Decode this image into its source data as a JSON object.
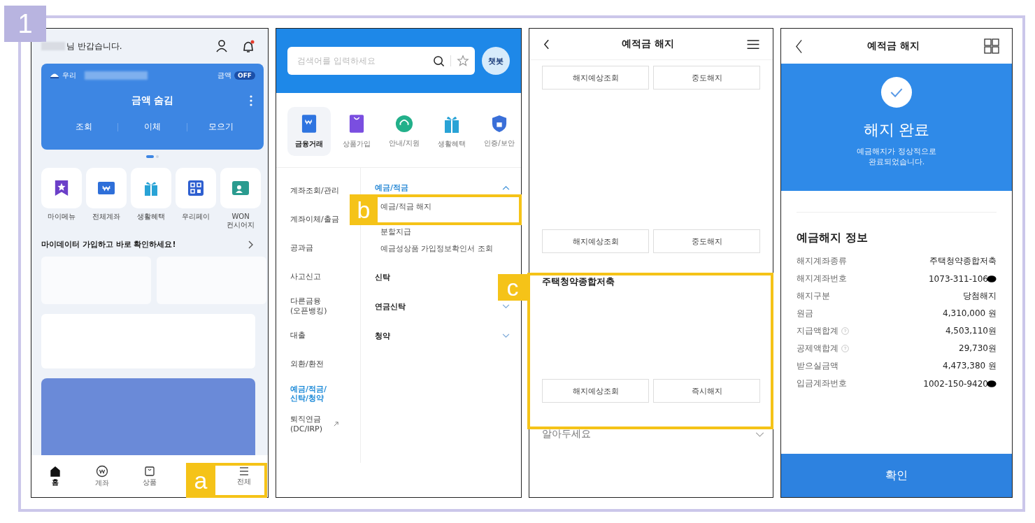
{
  "step_badge": "1",
  "annotations": [
    {
      "label": "a"
    },
    {
      "label": "b"
    },
    {
      "label": "c"
    }
  ],
  "home": {
    "greeting": "님 반갑습니다.",
    "account_card": {
      "bank": "우리",
      "toggle_label": "금액",
      "toggle": "OFF",
      "balance": "금액 숨김",
      "actions": [
        "조회",
        "이체",
        "모으기"
      ]
    },
    "pages": [
      {
        "selected": true
      },
      {
        "selected": false
      }
    ],
    "quick_menu": [
      {
        "label": "마이메뉴",
        "kind": "star"
      },
      {
        "label": "전체계좌",
        "kind": "won"
      },
      {
        "label": "생활혜택",
        "kind": "gift"
      },
      {
        "label": "우리페이",
        "kind": "qr"
      },
      {
        "label": "WON\n컨시어지",
        "kind": "concierge"
      }
    ],
    "mydata_banner": "마이데이터 가입하고 바로 확인하세요!",
    "nav": [
      {
        "label": "홈",
        "kind": "home",
        "selected": true
      },
      {
        "label": "계좌",
        "kind": "won",
        "selected": false
      },
      {
        "label": "상품",
        "kind": "bag",
        "selected": false
      },
      {
        "label": "전체",
        "kind": "menu",
        "selected": false
      }
    ]
  },
  "menu": {
    "search_placeholder": "검색어를 입력하세요",
    "chatbot": "챗봇",
    "categories": [
      {
        "label": "금융거래",
        "kind": "won",
        "selected": true
      },
      {
        "label": "상품가입",
        "kind": "bag",
        "selected": false
      },
      {
        "label": "안내/지원",
        "kind": "headset",
        "selected": false
      },
      {
        "label": "생활혜택",
        "kind": "gift",
        "selected": false
      },
      {
        "label": "인증/보안",
        "kind": "shield",
        "selected": false
      }
    ],
    "sidebar": [
      {
        "label": "계좌조회/관리",
        "selected": false
      },
      {
        "label": "계좌이체/출금",
        "selected": false
      },
      {
        "label": "공과금",
        "selected": false
      },
      {
        "label": "사고신고",
        "selected": false
      },
      {
        "label": "다른금융\n(오픈뱅킹)",
        "selected": false
      },
      {
        "label": "대출",
        "selected": false
      },
      {
        "label": "외환/환전",
        "selected": false
      },
      {
        "label": "예금/적금/\n신탁/청약",
        "selected": true
      },
      {
        "label": "퇴직연금\n(DC/IRP)",
        "selected": false,
        "external": true
      }
    ],
    "sections": [
      {
        "title": "예금/적금",
        "expanded": true,
        "items": [
          "예금/적금 해지",
          "분할지급",
          "예금성상품 가입정보확인서 조회"
        ]
      },
      {
        "title": "신탁"
      },
      {
        "title": "연금신탁",
        "expanded": false
      },
      {
        "title": "청약",
        "expanded": false
      }
    ]
  },
  "termination": {
    "title": "예적금 해지",
    "products": [
      {
        "buttons": [
          "해지예상조회",
          "중도해지"
        ]
      },
      {
        "buttons": [
          "해지예상조회",
          "중도해지"
        ]
      },
      {
        "name": "주택청약종합저축",
        "buttons": [
          "해지예상조회",
          "즉시해지"
        ]
      }
    ],
    "notice": "알아두세요"
  },
  "result": {
    "title": "예적금 해지",
    "status": "해지 완료",
    "message": "예금해지가 정상적으로\n완료되었습니다.",
    "info_title": "예금해지 정보",
    "rows": [
      {
        "label": "해지계좌종류",
        "value": "주택청약종합저축"
      },
      {
        "label": "해지계좌번호",
        "value": "1073-311-106",
        "redacted": true
      },
      {
        "label": "해지구분",
        "value": "당첨해지"
      },
      {
        "label": "원금",
        "value": "4,310,000 원"
      },
      {
        "label": "지급액합계",
        "value": "4,503,110원",
        "help": true
      },
      {
        "label": "공제액합계",
        "value": "29,730원",
        "help": true
      },
      {
        "label": "받으실금액",
        "value": "4,473,380 원"
      },
      {
        "label": "입금계좌번호",
        "value": "1002-150-9420",
        "redacted": true
      }
    ],
    "confirm": "확인"
  }
}
